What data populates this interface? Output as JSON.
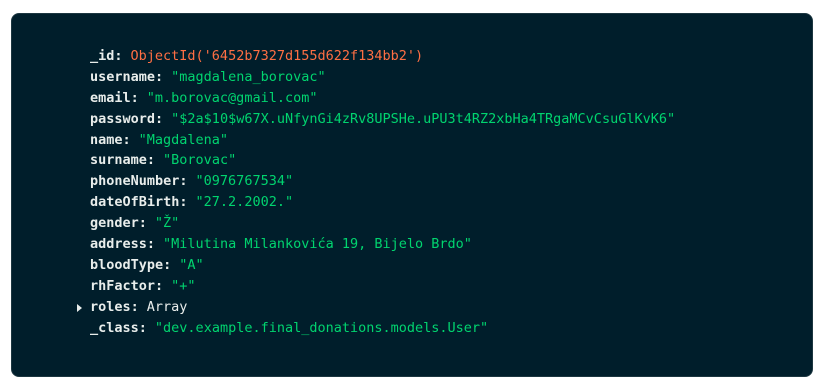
{
  "document": {
    "fields": [
      {
        "key": "_id",
        "value": "ObjectId('6452b7327d155d622f134bb2')",
        "kind": "oid"
      },
      {
        "key": "username",
        "value": "\"magdalena_borovac\"",
        "kind": "str"
      },
      {
        "key": "email",
        "value": "\"m.borovac@gmail.com\"",
        "kind": "str"
      },
      {
        "key": "password",
        "value": "\"$2a$10$w67X.uNfynGi4zRv8UPSHe.uPU3t4RZ2xbHa4TRgaMCvCsuGlKvK6\"",
        "kind": "str"
      },
      {
        "key": "name",
        "value": "\"Magdalena\"",
        "kind": "str"
      },
      {
        "key": "surname",
        "value": "\"Borovac\"",
        "kind": "str"
      },
      {
        "key": "phoneNumber",
        "value": "\"0976767534\"",
        "kind": "str"
      },
      {
        "key": "dateOfBirth",
        "value": "\"27.2.2002.\"",
        "kind": "str"
      },
      {
        "key": "gender",
        "value": "\"Ž\"",
        "kind": "str"
      },
      {
        "key": "address",
        "value": "\"Milutina Milankovića 19, Bijelo Brdo\"",
        "kind": "str"
      },
      {
        "key": "bloodType",
        "value": "\"A\"",
        "kind": "str"
      },
      {
        "key": "rhFactor",
        "value": "\"+\"",
        "kind": "str"
      },
      {
        "key": "roles",
        "value": "Array",
        "kind": "type",
        "expandable": true
      },
      {
        "key": "_class",
        "value": "\"dev.example.final_donations.models.User\"",
        "kind": "str"
      }
    ],
    "colon": ":"
  },
  "colors": {
    "background": "#001e2b",
    "key": "#e8edeb",
    "string": "#00d46f",
    "objectid": "#ff6f44"
  }
}
